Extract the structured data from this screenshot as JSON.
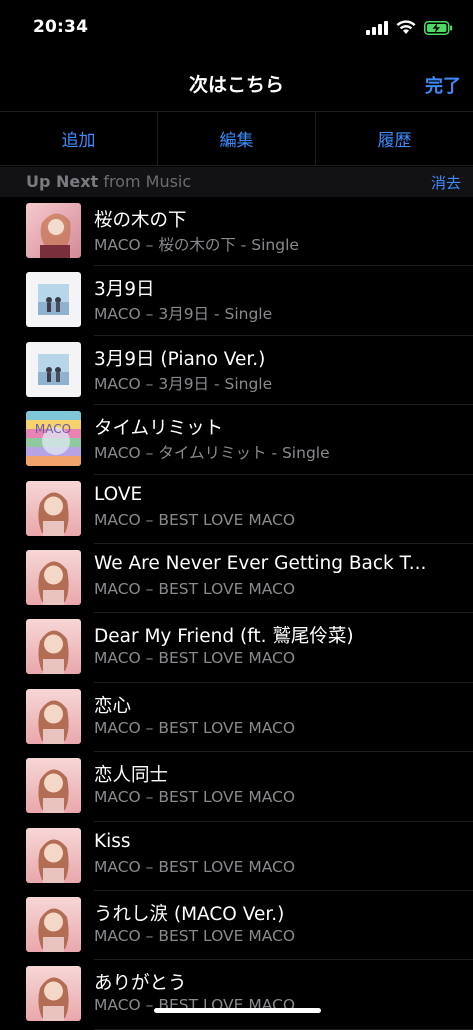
{
  "status": {
    "time": "20:34"
  },
  "nav": {
    "title": "次はこちら",
    "done": "完了"
  },
  "segments": [
    "追加",
    "編集",
    "履歴"
  ],
  "section": {
    "title_bold": "Up Next",
    "title_rest": " from Music",
    "clear": "消去"
  },
  "songs": [
    {
      "title": "桜の木の下",
      "subtitle": "MACO – 桜の木の下 - Single",
      "art": "sakura-art"
    },
    {
      "title": "3月9日",
      "subtitle": "MACO – 3月9日 - Single",
      "art": "march9-art"
    },
    {
      "title": "3月9日 (Piano Ver.)",
      "subtitle": "MACO – 3月9日 - Single",
      "art": "march9-art"
    },
    {
      "title": "タイムリミット",
      "subtitle": "MACO – タイムリミット - Single",
      "art": "timelimit-art"
    },
    {
      "title": "LOVE",
      "subtitle": "MACO – BEST LOVE MACO",
      "art": "best-love-art"
    },
    {
      "title": "We Are Never Ever Getting Back T...",
      "subtitle": "MACO – BEST LOVE MACO",
      "art": "best-love-art"
    },
    {
      "title": "Dear My Friend (ft. 鷲尾伶菜)",
      "subtitle": "MACO – BEST LOVE MACO",
      "art": "best-love-art"
    },
    {
      "title": "恋心",
      "subtitle": "MACO – BEST LOVE MACO",
      "art": "best-love-art"
    },
    {
      "title": "恋人同士",
      "subtitle": "MACO – BEST LOVE MACO",
      "art": "best-love-art"
    },
    {
      "title": "Kiss",
      "subtitle": "MACO – BEST LOVE MACO",
      "art": "best-love-art"
    },
    {
      "title": "うれし涙 (MACO Ver.)",
      "subtitle": "MACO – BEST LOVE MACO",
      "art": "best-love-art"
    },
    {
      "title": "ありがとう",
      "subtitle": "MACO – BEST LOVE MACO",
      "art": "best-love-art"
    }
  ],
  "colors": {
    "accent": "#3d8bfd",
    "background": "#000000",
    "secondary_text": "#8a8a8e"
  }
}
